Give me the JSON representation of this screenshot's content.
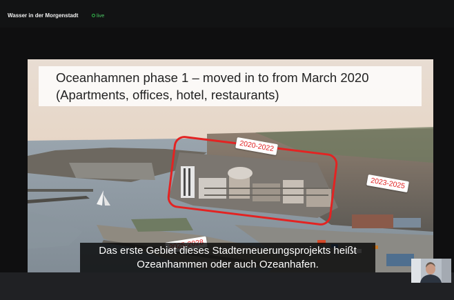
{
  "meeting": {
    "title": "Wasser in der Morgenstadt",
    "status": "live",
    "status_color": "#2fbf4a"
  },
  "slide": {
    "title_line1": "Oceanhamnen  phase 1 – moved in to from March 2020",
    "title_line2": "(Apartments, offices, hotel, restaurants)",
    "labels": [
      "2020-2022",
      "2023-2025",
      "2025-2028"
    ],
    "highlight_color": "#e32322"
  },
  "subtitles": {
    "line1": "Das erste Gebiet dieses Stadterneuerungsprojekts heißt",
    "line2": "Ozeanhammen oder auch Ozeanhafen."
  },
  "participant": {
    "video": "webcam-thumbnail"
  }
}
